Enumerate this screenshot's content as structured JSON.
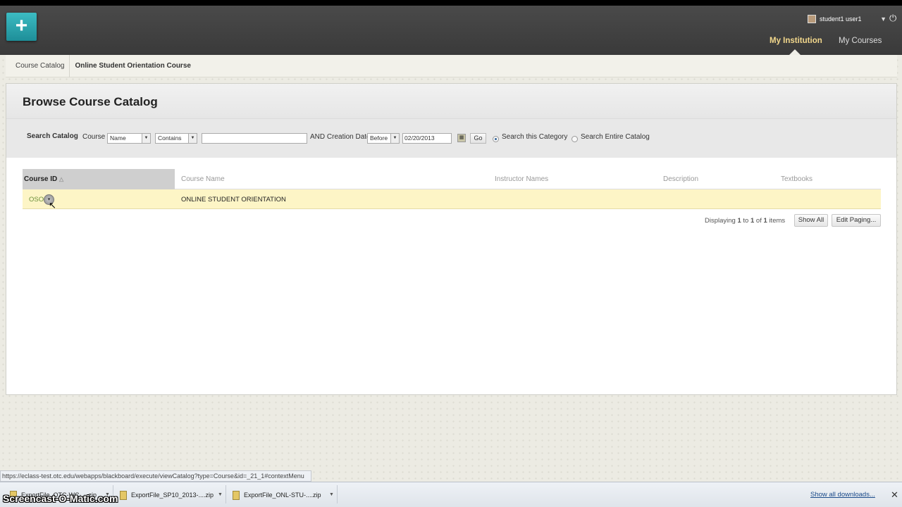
{
  "header": {
    "logo_symbol": "+",
    "user_name": "student1 user1",
    "power_symbol": "⏻",
    "nav": {
      "my_institution": "My Institution",
      "my_courses": "My Courses"
    }
  },
  "breadcrumb": [
    "Course Catalog",
    "Online Student Orientation Course"
  ],
  "page_title": "Browse Course Catalog",
  "search": {
    "label": "Search Catalog",
    "course_label": "Course",
    "field_select": "Name",
    "operator_select": "Contains",
    "query_value": "",
    "date_label": "AND Creation Date",
    "date_op_select": "Before",
    "date_value": "02/20/2013",
    "go_label": "Go",
    "radio_category": "Search this Category",
    "radio_entire": "Search Entire Catalog",
    "selected_scope": "Search this Category"
  },
  "table": {
    "columns": [
      "Course ID",
      "Course Name",
      "Instructor Names",
      "Description",
      "Textbooks"
    ],
    "rows": [
      {
        "id": "OSO",
        "name": "ONLINE STUDENT ORIENTATION",
        "instructors": "",
        "description": "",
        "textbooks": ""
      }
    ]
  },
  "paging": {
    "prefix": "Displaying",
    "from": "1",
    "to_word": "to",
    "to": "1",
    "of_word": "of",
    "total": "1",
    "suffix": "items",
    "show_all": "Show All",
    "edit_paging": "Edit Paging..."
  },
  "status_url": "https://eclass-test.otc.edu/webapps/blackboard/execute/viewCatalog?type=Course&id=_21_1#contextMenu",
  "downloads": {
    "items": [
      "ExportFile_OTC-WC-....zip",
      "ExportFile_SP10_2013-....zip",
      "ExportFile_ONL-STU-....zip"
    ],
    "show_all": "Show all downloads...",
    "close_symbol": "✕"
  },
  "watermark": "Screencast-O-Matic.com"
}
